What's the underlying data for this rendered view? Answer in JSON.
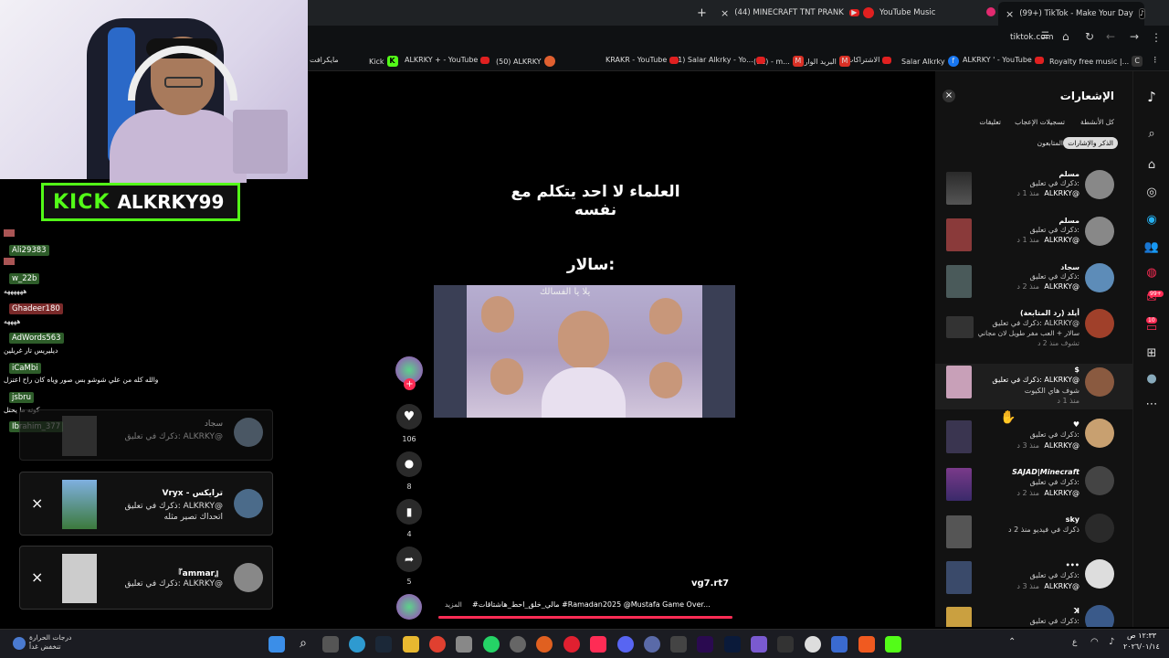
{
  "browser": {
    "tabs": [
      {
        "label": "(44) MINECRAFT TNT PRANK",
        "icon": "youtube-icon"
      },
      {
        "label": "YouTube Music",
        "icon": "youtube-music-icon"
      },
      {
        "label": "(99+) TikTok - Make Your Day",
        "icon": "tiktok-icon",
        "active": true
      }
    ],
    "new_tab": "+",
    "close_tab": "×",
    "address": "tiktok.com",
    "bookmarks": [
      "Royalty free music |...",
      "ALKRKY ' - YouTube",
      "Salar Alkrky",
      "الاشتراكات",
      "البريد الوارد",
      "(11) - m...",
      "(1) Salar Alkrky - Yo...",
      "KRAKR - YouTube",
      "(50) ALKRKY",
      "ALKRKY + - YouTube",
      "Kick",
      "مايكرافت"
    ]
  },
  "stream": {
    "kick_logo": "KICK",
    "channel": "ALKRKY99"
  },
  "chat": {
    "messages": [
      {
        "user": "Ali29383",
        "text": "",
        "color": "#4a8c3f"
      },
      {
        "user": "w_22b",
        "text": "ههههههه",
        "color": "#4a8c3f"
      },
      {
        "user": "Ghadeer180",
        "text": "ههههه",
        "color": "#b03a3a"
      },
      {
        "user": "AdWords563",
        "text": "ديليريس تار غريلين",
        "color": "#4a8c3f"
      },
      {
        "user": "iCaMbi",
        "text": "والله كله من علي شوشو بس صور وياه كان راح اعتزل",
        "color": "#4a8c3f"
      },
      {
        "user": "jsbru",
        "text": "كونه ما يحتل",
        "color": "#4a8c3f"
      },
      {
        "user": "Ibrahim_377",
        "text": "",
        "color": "#4a8c3f"
      }
    ],
    "cards": [
      {
        "name": "سجاد",
        "text": "ذكرك في تعليق: ALKRKY@"
      },
      {
        "name": "Vryx - ترايكس",
        "text": "ذكرك في تعليق: ALKRKY@",
        "extra": "اتحداك تصير مثله",
        "close": "×"
      },
      {
        "name": "『ammar』",
        "text": "ذكرك في تعليق: ALKRKY@",
        "close": "×"
      }
    ]
  },
  "video": {
    "caption_top": "العلماء لا احد يتكلم مع نفسه",
    "caption_mid": "سالار:",
    "overlay_text": "يلا يا الفسالك",
    "author": "vg7.rt7",
    "description": "#مالي_خلق_احط_هاشتاقات #Ramadan2025 @Mustafa Game Over...",
    "more": "المزيد",
    "likes": "106",
    "comments": "8",
    "saves": "4",
    "shares": "5"
  },
  "notifications": {
    "title": "الإشعارات",
    "close": "×",
    "filters": [
      "كل الأنشطة",
      "تسجيلات الإعجاب",
      "تعليقات",
      "الذكر والإشارات",
      "المتابعون"
    ],
    "items": [
      {
        "name": "مسلم",
        "line1": "ذكرك في تعليق:",
        "line2": "ALKRKY@",
        "time": "منذ 1 د"
      },
      {
        "name": "مسلم",
        "line1": "ذكرك في تعليق:",
        "line2": "ALKRKY@",
        "time": "منذ 1 د"
      },
      {
        "name": "سجاد",
        "line1": "ذكرك في تعليق:",
        "line2": "ALKRKY@",
        "time": "منذ 2 د"
      },
      {
        "name": "أيلد (رد المتابعة)",
        "line1": "ذكرك في تعليق: ALKRKY@",
        "line2": "سالار + العب مفر طويل لان مجاني",
        "time": "تشوف منذ 2 د"
      },
      {
        "name": "$",
        "line1": "ذكرك في تعليق: ALKRKY@",
        "line2": "شوف هاي الكيوت",
        "time": "منذ 1 د"
      },
      {
        "name": "♥",
        "line1": "ذكرك في تعليق:",
        "line2": "ALKRKY@",
        "time": "منذ 3 د"
      },
      {
        "name": "SAJAD|Minecraft",
        "line1": "ذكرك في تعليق:",
        "line2": "ALKRKY@",
        "time": "منذ 2 د"
      },
      {
        "name": "sky",
        "line1": "ذكرك في فيديو منذ 2 د",
        "line2": "",
        "time": ""
      },
      {
        "name": "•••",
        "line1": "ذكرك في تعليق:",
        "line2": "ALKRKY@",
        "time": "منذ 3 د"
      },
      {
        "name": "ꓘ",
        "line1": "ذكرك في تعليق:",
        "line2": "",
        "time": ""
      }
    ]
  },
  "rail": {
    "badge_99": "99+",
    "badge_10": "10"
  },
  "taskbar": {
    "weather": "درجات الحرارة تنخفض غداً",
    "time": "١٢:٣٣ ص",
    "date": "٢٠٢٦/٠١/١٤",
    "lang": "ع"
  },
  "colors": {
    "kick_green": "#53fc18",
    "tiktok_red": "#fe2c55",
    "browser_bg": "#1f2225"
  }
}
